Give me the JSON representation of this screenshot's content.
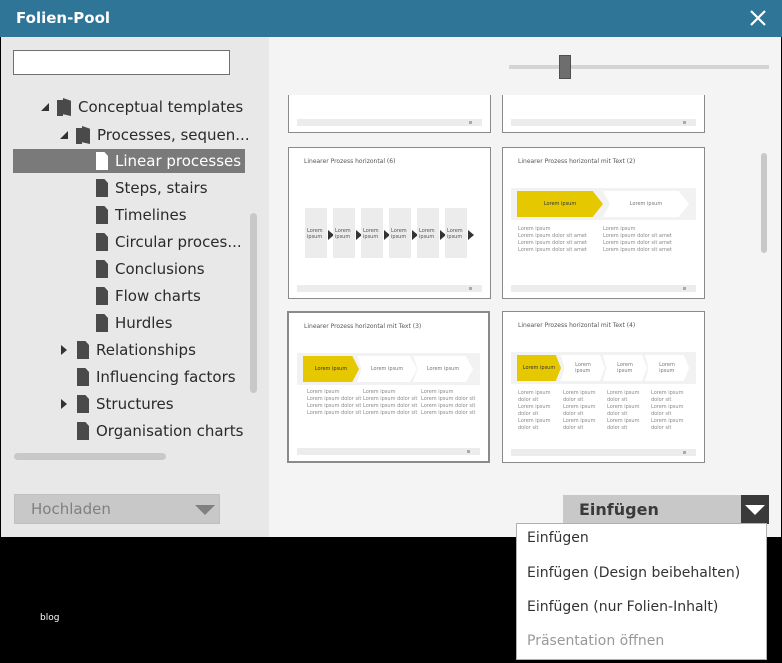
{
  "window": {
    "title": "Folien-Pool"
  },
  "search": {
    "value": "",
    "placeholder": ""
  },
  "tree": {
    "items": [
      {
        "label": "Conceptual templates",
        "type": "book",
        "expanded": true
      },
      {
        "label": "Processes,  sequen...",
        "type": "book",
        "expanded": true
      },
      {
        "label": "Linear processes",
        "type": "doc",
        "selected": true
      },
      {
        "label": "Steps, stairs",
        "type": "doc"
      },
      {
        "label": "Timelines",
        "type": "doc"
      },
      {
        "label": "Circular  proces...",
        "type": "doc"
      },
      {
        "label": "Conclusions",
        "type": "doc"
      },
      {
        "label": "Flow charts",
        "type": "doc"
      },
      {
        "label": "Hurdles",
        "type": "doc"
      },
      {
        "label": "Relationships",
        "type": "doc",
        "collapsed": true
      },
      {
        "label": "Influencing factors",
        "type": "doc"
      },
      {
        "label": "Structures",
        "type": "doc",
        "collapsed": true
      },
      {
        "label": "Organisation charts",
        "type": "doc"
      }
    ]
  },
  "upload": {
    "label": "Hochladen"
  },
  "zoom": {
    "level": 0.2
  },
  "thumbnails": [
    {
      "title": "Linearer Prozess horizontal (6)",
      "boxes": [
        "Lorem\nipsum",
        "Lorem\nipsum",
        "Lorem\nipsum",
        "Lorem\nipsum",
        "Lorem\nipsum",
        "Lorem\nipsum"
      ]
    },
    {
      "title": "Linearer Prozess horizontal mit Text (2)",
      "chevrons": [
        "Lorem ipsum",
        "Lorem ipsum"
      ],
      "text": "Lorem ipsum\nLorem ipsum dolor sit amet\nLorem ipsum dolor sit amet\nLorem ipsum dolor sit amet"
    },
    {
      "title": "Linearer Prozess horizontal mit Text (3)",
      "chevrons": [
        "Lorem ipsum",
        "Lorem ipsum",
        "Lorem ipsum"
      ],
      "text": "Lorem ipsum\nLorem ipsum dolor sit\nLorem ipsum dolor sit\nLorem ipsum dolor sit",
      "selected": true
    },
    {
      "title": "Linearer Prozess horizontal mit Text (4)",
      "chevrons": [
        "Lorem ipsum",
        "Lorem\nipsum",
        "Lorem\nipsum",
        "Lorem\nipsum"
      ],
      "text": "Lorem ipsum\ndolor sit\nLorem ipsum\ndolor sit\nLorem ipsum\ndolor sit"
    }
  ],
  "insert": {
    "label": "Einfügen",
    "menu": [
      {
        "label": "Einfügen",
        "enabled": true
      },
      {
        "label": "Einfügen (Design beibehalten)",
        "enabled": true
      },
      {
        "label": "Einfügen (nur Folien-Inhalt)",
        "enabled": true
      },
      {
        "label": "Präsentation öffnen",
        "enabled": false
      }
    ]
  },
  "footer": {
    "text": "blog"
  },
  "colors": {
    "titlebar": "#2f7597",
    "accent_yellow": "#e5c800",
    "selection": "#7a7a7a"
  }
}
